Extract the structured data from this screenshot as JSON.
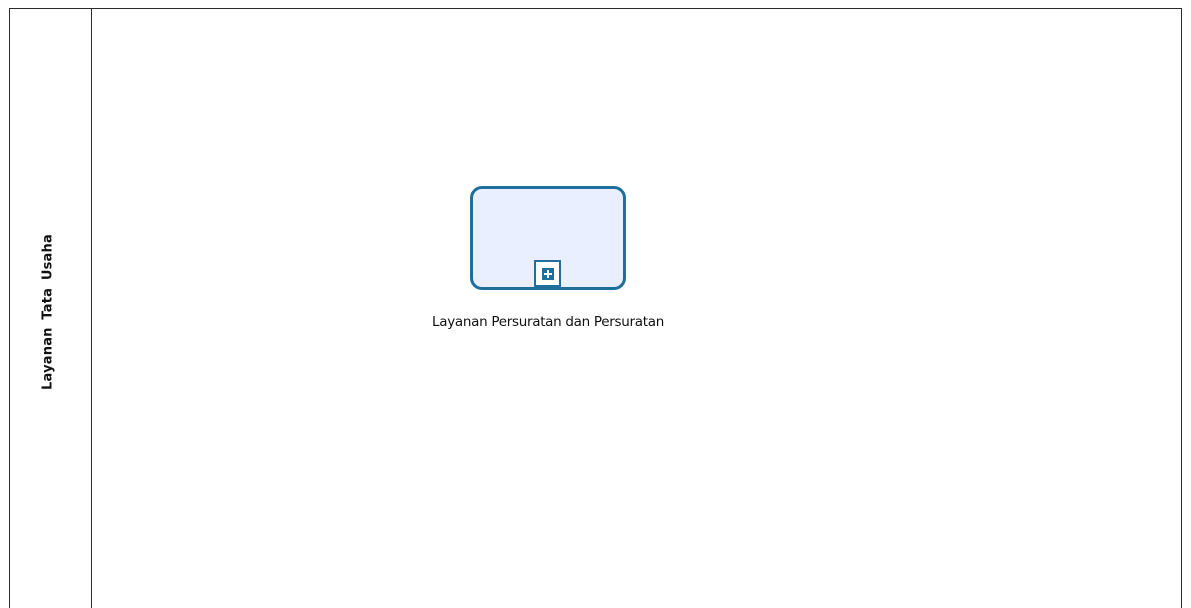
{
  "diagram": {
    "type": "bpmn",
    "lane": {
      "label": "Layanan  Tata  Usaha"
    },
    "subprocess": {
      "label": "Layanan Persuratan dan Persuratan",
      "collapsed": true,
      "marker_icon": "plus-icon",
      "colors": {
        "border": "#1e6f9b",
        "fill": "#eaefff"
      }
    }
  }
}
